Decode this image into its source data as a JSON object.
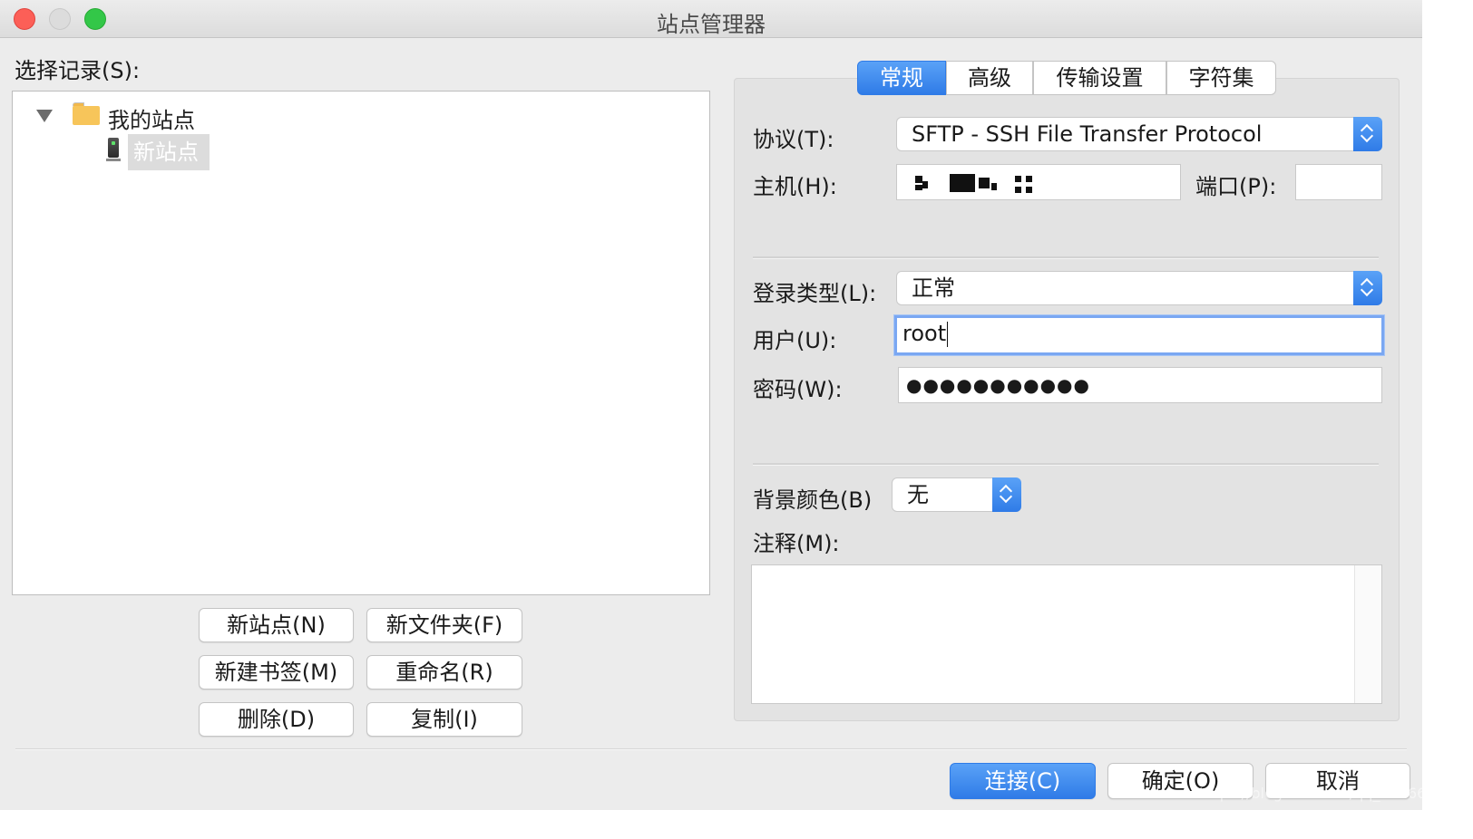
{
  "window": {
    "title": "站点管理器"
  },
  "left": {
    "select_label": "选择记录(S):",
    "tree": {
      "root": "我的站点",
      "selected_child": "新站点"
    },
    "buttons": {
      "new_site": "新站点(N)",
      "new_folder": "新文件夹(F)",
      "new_bookmark": "新建书签(M)",
      "rename": "重命名(R)",
      "delete": "删除(D)",
      "copy": "复制(I)"
    }
  },
  "tabs": [
    {
      "label": "常规",
      "active": true
    },
    {
      "label": "高级",
      "active": false
    },
    {
      "label": "传输设置",
      "active": false
    },
    {
      "label": "字符集",
      "active": false
    }
  ],
  "form": {
    "protocol_label": "协议(T):",
    "protocol_value": "SFTP - SSH File Transfer Protocol",
    "host_label": "主机(H):",
    "port_label": "端口(P):",
    "port_value": "",
    "logon_type_label": "登录类型(L):",
    "logon_type_value": "正常",
    "user_label": "用户(U):",
    "user_value": "root",
    "password_label": "密码(W):",
    "password_value": "●●●●●●●●●●●",
    "bg_color_label": "背景颜色(B)",
    "bg_color_value": "无",
    "comments_label": "注释(M):"
  },
  "footer": {
    "connect": "连接(C)",
    "ok": "确定(O)",
    "cancel": "取消"
  },
  "watermark": "https://blog.csdn.net/qq_43166688",
  "colors": {
    "accent": "#2f7be7",
    "window_bg": "#ececec"
  }
}
